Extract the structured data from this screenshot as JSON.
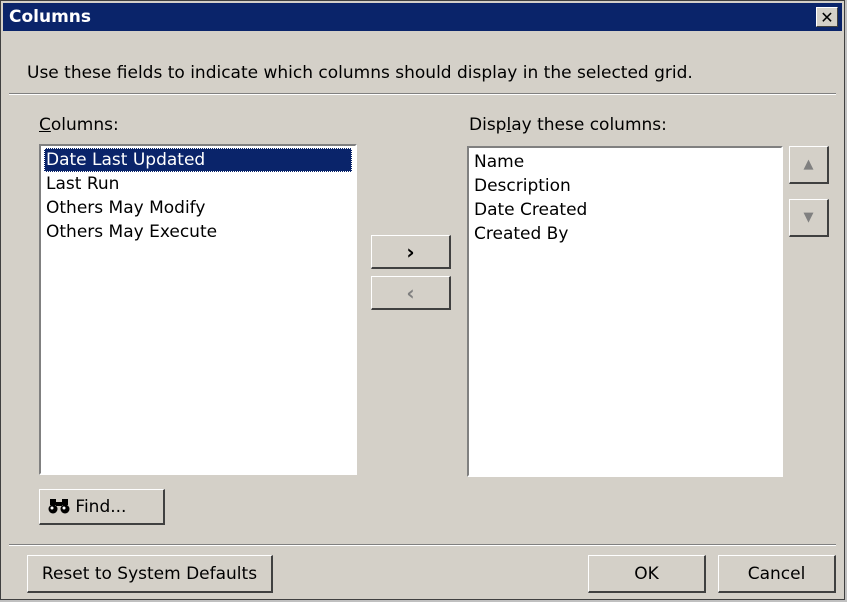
{
  "dialog": {
    "title": "Columns",
    "close_label": "✕",
    "instructions": "Use these fields to indicate which columns should display in the selected grid."
  },
  "available": {
    "label_accel": "C",
    "label_rest": "olumns:",
    "items": [
      "Date Last Updated",
      "Last Run",
      "Others May Modify",
      "Others May Execute"
    ],
    "selected_index": 0
  },
  "display": {
    "label_pre": "Disp",
    "label_accel": "l",
    "label_post": "ay these columns:",
    "items": [
      "Name",
      "Description",
      "Date Created",
      "Created By"
    ]
  },
  "buttons": {
    "add": "›",
    "remove": "‹",
    "move_up": "▲",
    "move_down": "▼",
    "find": "Find...",
    "reset": "Reset to System Defaults",
    "ok": "OK",
    "cancel": "Cancel"
  },
  "icons": {
    "find": "binoculars-icon",
    "close": "close-icon"
  },
  "colors": {
    "title_bar": "#0a246a",
    "selection": "#0a246a",
    "face": "#d4d0c8"
  }
}
